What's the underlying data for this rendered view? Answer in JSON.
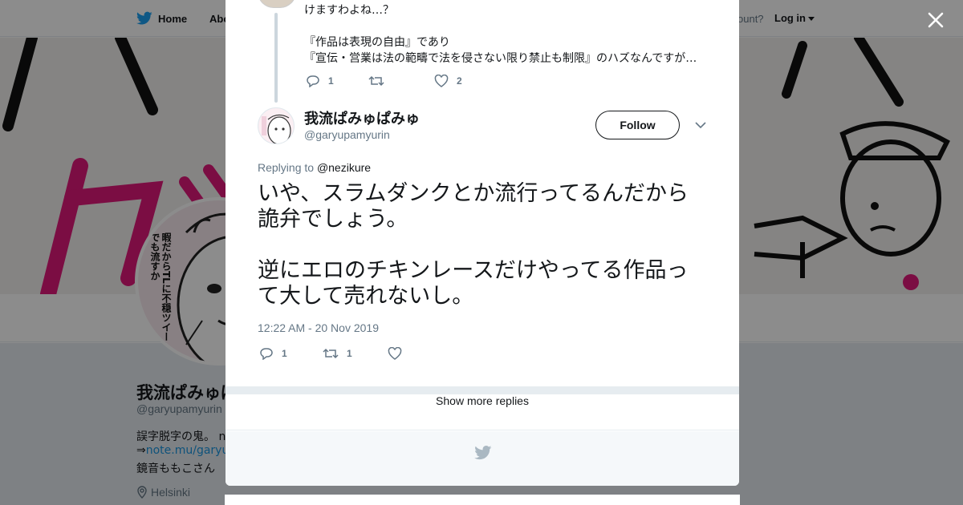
{
  "topnav": {
    "home_label": "Home",
    "about_label": "Abo",
    "account_text": "ccount?",
    "login_label": "Log in"
  },
  "profile": {
    "name": "我流ぱみゅぱ",
    "handle": "@garyupamyurin",
    "bio_line1": "誤字脱字の鬼。 n",
    "bio_line2_prefix": "⇒",
    "bio_line2_link": "note.mu/garyup",
    "bio_line3": "鏡音ももこさん",
    "location": "Helsinki",
    "avatar_caption": "暇だからTLに不穏ツイートでも流すか"
  },
  "modal": {
    "parent_tweet": {
      "line1": "けますわよね…？",
      "line2": "『作品は表現の自由』であり",
      "line3": "『宣伝・営業は法の範疇で法を侵さない限り禁止も制限』のハズなんですが…",
      "reply_count": "1",
      "retweet_count": "",
      "like_count": "2"
    },
    "reply_tweet": {
      "display_name": "我流ぱみゅぱみゅ",
      "handle": "@garyupamyurin",
      "follow_label": "Follow",
      "replying_prefix": "Replying to",
      "replying_to": "@nezikure",
      "text_p1": "いや、スラムダンクとか流行ってるんだから詭弁でしょう。",
      "text_p2": "逆にエロのチキンレースだけやってる作品って大して売れないし。",
      "timestamp": "12:22 AM - 20 Nov 2019",
      "reply_count": "1",
      "retweet_count": "1",
      "like_count": ""
    },
    "show_more_label": "Show more replies"
  },
  "colors": {
    "accent": "#1da1f2",
    "text": "#14171a",
    "muted": "#657786",
    "banner_pink": "#e0187a"
  }
}
